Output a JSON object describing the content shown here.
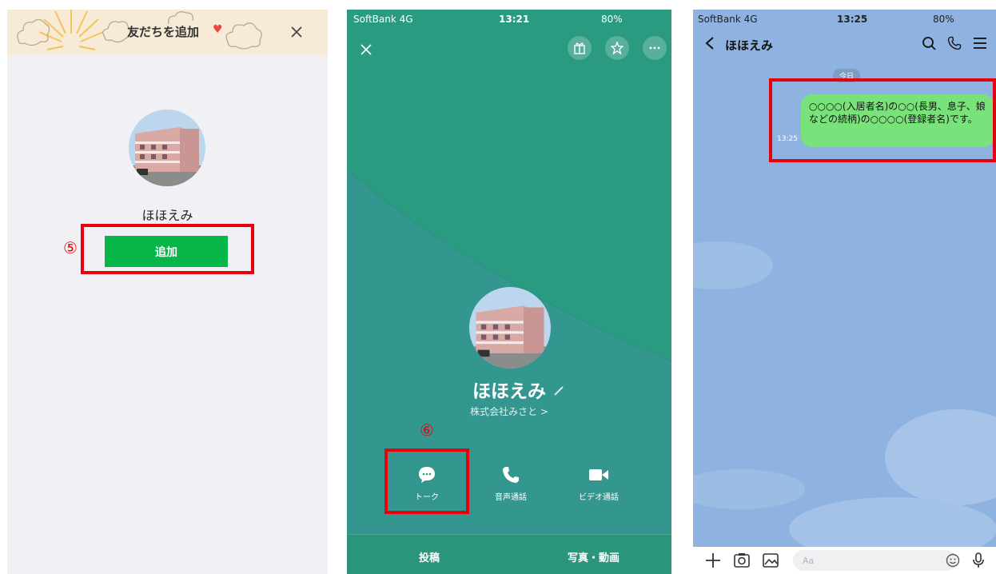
{
  "panel_add": {
    "header_title": "友だちを追加",
    "close_glyph": "×",
    "profile_name": "ほほえみ",
    "add_button_label": "追加",
    "step_marker": "⑤"
  },
  "panel_profile": {
    "status_carrier": "SoftBank  4G",
    "status_time": "13:21",
    "status_battery": "80%",
    "profile_name": "ほほえみ",
    "company": "株式会社みさと >",
    "step_marker": "⑥",
    "actions": [
      {
        "label": "トーク",
        "icon": "chat-bubble-icon"
      },
      {
        "label": "音声通話",
        "icon": "phone-icon"
      },
      {
        "label": "ビデオ通話",
        "icon": "video-camera-icon"
      }
    ],
    "tabs": [
      "投稿",
      "写真・動画"
    ]
  },
  "panel_chat": {
    "status_carrier": "SoftBank  4G",
    "status_time": "13:25",
    "status_battery": "80%",
    "chat_title": "ほほえみ",
    "date_chip": "今日",
    "message_text": "○○○○(入居者名)の○○(長男、息子、娘などの続柄)の○○○○(登録者名)です。",
    "message_time": "13:25",
    "input_placeholder": "Aa"
  },
  "colors": {
    "line_green": "#06b648",
    "highlight_red": "#e8000b",
    "profile_teal": "#2a9d82",
    "chat_bg": "#8eb3e0",
    "bubble_green": "#79e27a"
  }
}
